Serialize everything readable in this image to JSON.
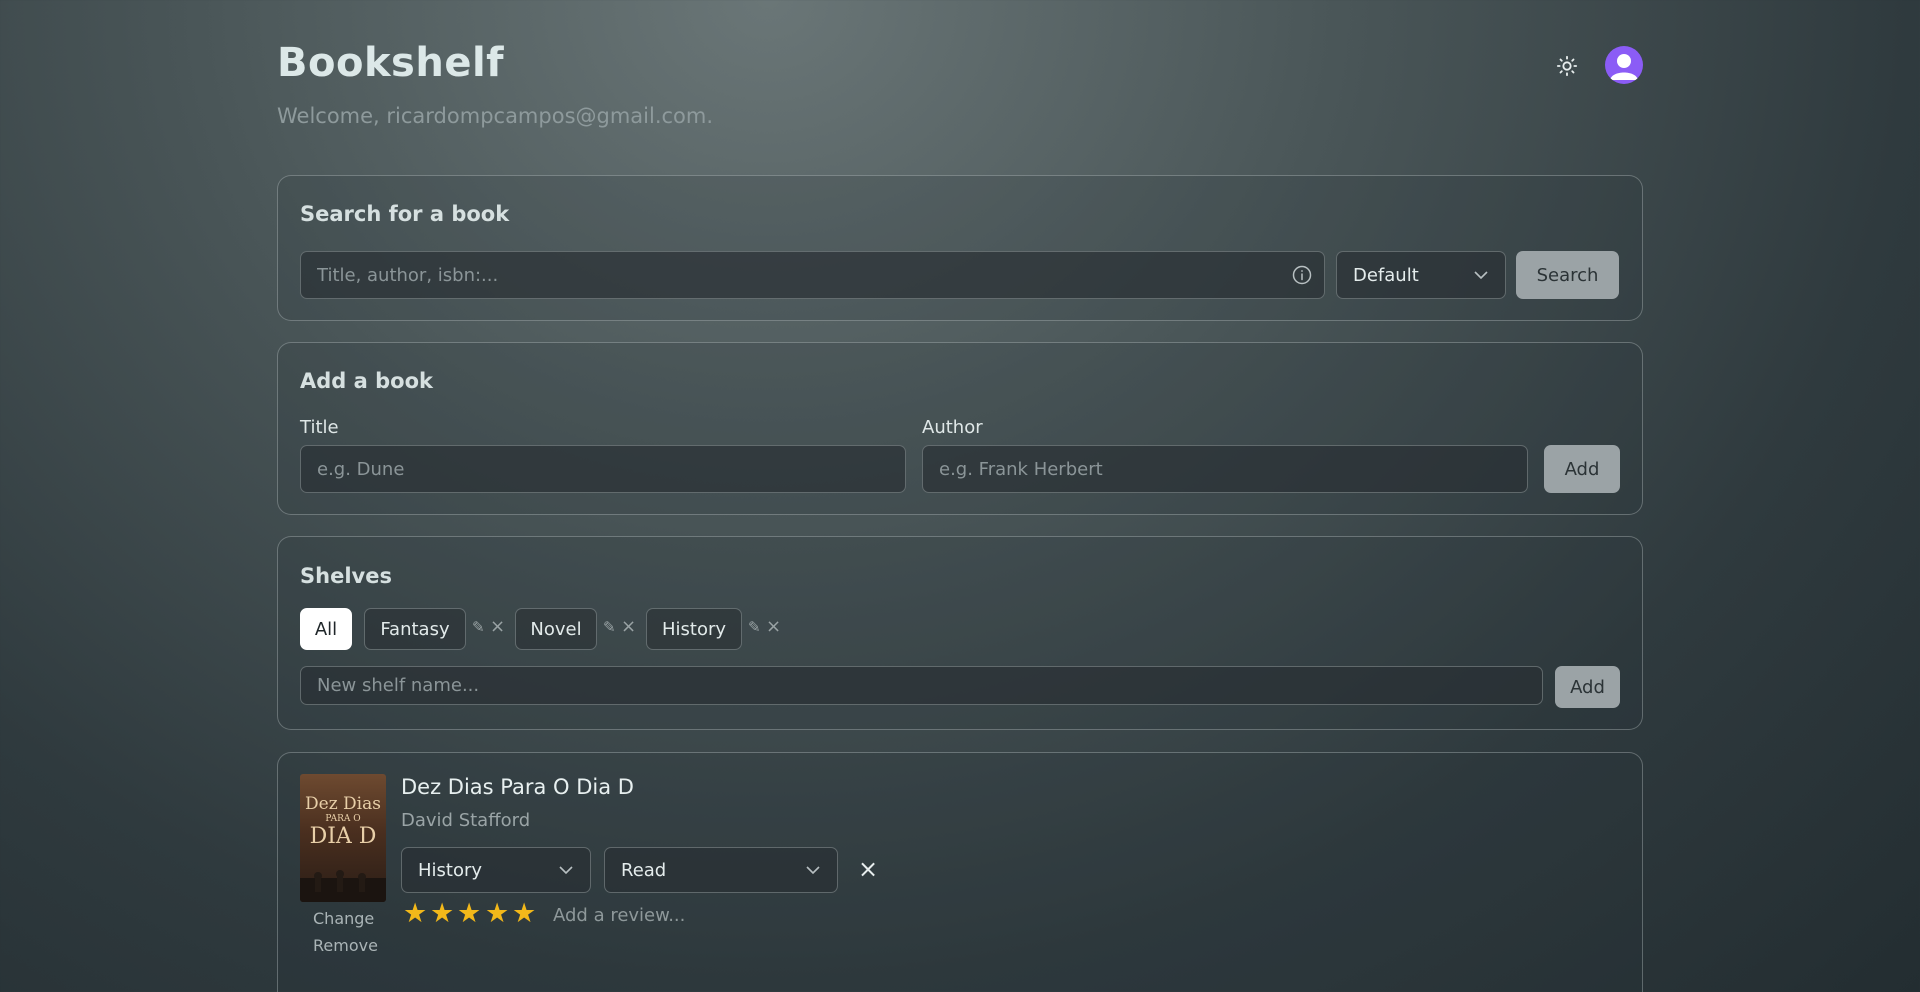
{
  "app": {
    "title": "Bookshelf",
    "welcome": "Welcome, ricardompcampos@gmail.com."
  },
  "header": {
    "theme_icon": "sun-icon",
    "avatar_icon": "user-icon",
    "accent": "#8b5cf6"
  },
  "search": {
    "heading": "Search for a book",
    "placeholder": "Title, author, isbn:...",
    "info_icon": "info-icon",
    "mode": "Default",
    "button": "Search"
  },
  "add_book": {
    "heading": "Add a book",
    "title_label": "Title",
    "title_placeholder": "e.g. Dune",
    "author_label": "Author",
    "author_placeholder": "e.g. Frank Herbert",
    "button": "Add"
  },
  "shelves": {
    "heading": "Shelves",
    "items": [
      {
        "label": "All",
        "active": true
      },
      {
        "label": "Fantasy",
        "active": false
      },
      {
        "label": "Novel",
        "active": false
      },
      {
        "label": "History",
        "active": false
      }
    ],
    "edit_glyph": "✎",
    "delete_glyph": "×",
    "new_placeholder": "New shelf name...",
    "button": "Add"
  },
  "books": [
    {
      "title": "Dez Dias Para O Dia D",
      "author": "David Stafford",
      "cover_text": [
        "Dez Dias",
        "PARA O",
        "DIA D"
      ],
      "shelf": "History",
      "status": "Read",
      "rating": 5,
      "remove_glyph": "×",
      "change_label": "Change",
      "remove_label": "Remove",
      "review_placeholder": "Add a review..."
    }
  ],
  "colors": {
    "star": "#f2b81a",
    "button": "#9ba3a6"
  }
}
